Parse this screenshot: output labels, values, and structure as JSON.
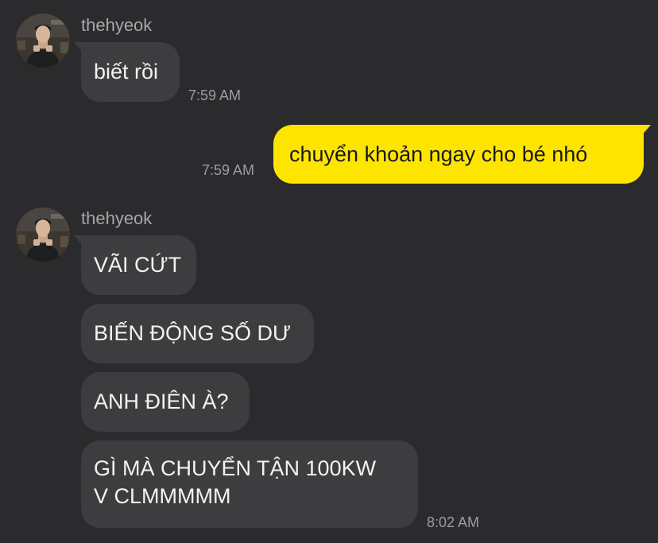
{
  "colors": {
    "background": "#2b2b2d",
    "incoming_bubble": "#3d3d40",
    "outgoing_bubble": "#fee500",
    "sender_name": "#a7a7aa",
    "timestamp": "#9d9da0"
  },
  "groups": [
    {
      "sender": "thehyeok",
      "avatar_icon": "profile-photo-avatar",
      "messages": [
        {
          "text": "biết rồi"
        }
      ],
      "time": "7:59 AM"
    },
    {
      "sender": "me",
      "messages": [
        {
          "text": "chuyển khoản ngay cho bé nhó"
        }
      ],
      "time": "7:59 AM"
    },
    {
      "sender": "thehyeok",
      "avatar_icon": "profile-photo-avatar",
      "messages": [
        {
          "text": "VÃI CỨT"
        },
        {
          "text": "BIẾN ĐỘNG SỐ DƯ"
        },
        {
          "text": "ANH ĐIÊN À?"
        },
        {
          "text": "GÌ MÀ CHUYỂN TẬN 100KW\nV CLMMMMM"
        }
      ],
      "time": "8:02 AM"
    }
  ]
}
